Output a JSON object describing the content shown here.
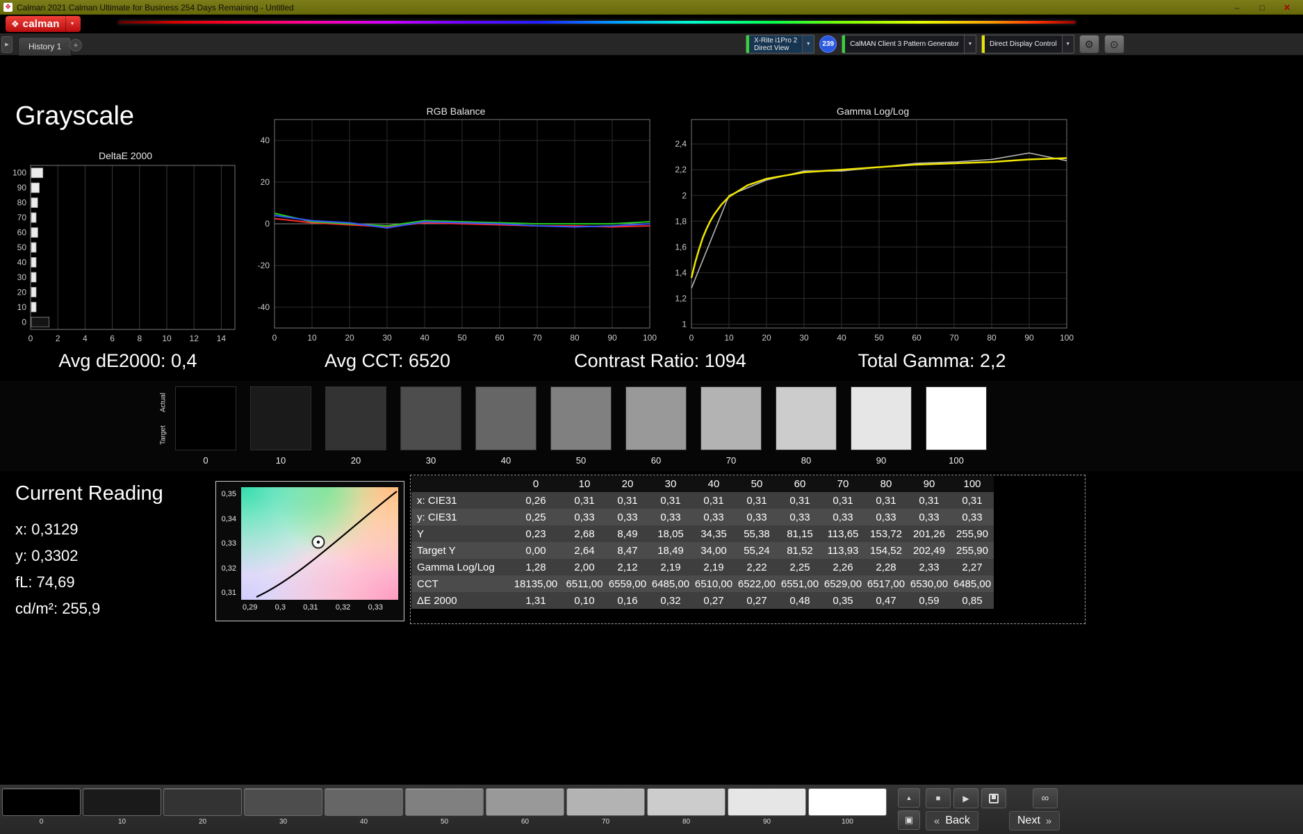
{
  "window": {
    "title": "Calman 2021 Calman Ultimate for Business 254 Days Remaining  - Untitled"
  },
  "icons": {
    "app_diamond": "❖",
    "minimize": "–",
    "maximize": "□",
    "close": "✕",
    "logo_diamond": "❖",
    "dropdown": "▼",
    "collapse": "▶",
    "add_tab": "+",
    "gear": "⚙",
    "power": "⊙",
    "up": "▲",
    "pattern_window": "▣",
    "stop": "■",
    "play": "▶",
    "infinity": "∞",
    "back_chevrons": "«",
    "next_chevrons": "»"
  },
  "brand": {
    "logo": "calman",
    "accent": "#c8102e"
  },
  "tabbar": {
    "history_tab": "History 1"
  },
  "devices": {
    "meter_line1": "X-Rite i1Pro 2",
    "meter_line2": "Direct View",
    "meter_accent": "#35d435",
    "badge": "239",
    "pattern_generator": "CalMAN Client 3 Pattern Generator",
    "pattern_accent": "#35d435",
    "display_control": "Direct Display Control",
    "display_accent": "#e8e400"
  },
  "page": {
    "title": "Grayscale"
  },
  "summary": {
    "avg_de": "Avg dE2000: 0,4",
    "avg_cct": "Avg CCT: 6520",
    "contrast": "Contrast Ratio: 1094",
    "total_gamma": "Total Gamma: 2,2"
  },
  "patches": {
    "row_label_top": "Actual",
    "row_label_bottom": "Target",
    "levels": [
      "0",
      "10",
      "20",
      "30",
      "40",
      "50",
      "60",
      "70",
      "80",
      "90",
      "100"
    ],
    "colors": [
      "#000000",
      "#1a1a1a",
      "#333333",
      "#4d4d4d",
      "#666666",
      "#808080",
      "#999999",
      "#b3b3b3",
      "#cccccc",
      "#e6e6e6",
      "#ffffff"
    ]
  },
  "current_reading": {
    "title": "Current Reading",
    "x": "x: 0,3129",
    "y": "y: 0,3302",
    "fl": "fL: 74,69",
    "cd": "cd/m²: 255,9"
  },
  "cie": {
    "x_ticks": [
      "0,29",
      "0,3",
      "0,31",
      "0,32",
      "0,33"
    ],
    "y_ticks": [
      "0,35",
      "0,34",
      "0,33",
      "0,32",
      "0,31"
    ]
  },
  "table": {
    "columns": [
      "",
      "0",
      "10",
      "20",
      "30",
      "40",
      "50",
      "60",
      "70",
      "80",
      "90",
      "100"
    ],
    "rows": [
      {
        "label": "x: CIE31",
        "values": [
          "0,26",
          "0,31",
          "0,31",
          "0,31",
          "0,31",
          "0,31",
          "0,31",
          "0,31",
          "0,31",
          "0,31",
          "0,31"
        ]
      },
      {
        "label": "y: CIE31",
        "values": [
          "0,25",
          "0,33",
          "0,33",
          "0,33",
          "0,33",
          "0,33",
          "0,33",
          "0,33",
          "0,33",
          "0,33",
          "0,33"
        ]
      },
      {
        "label": "Y",
        "values": [
          "0,23",
          "2,68",
          "8,49",
          "18,05",
          "34,35",
          "55,38",
          "81,15",
          "113,65",
          "153,72",
          "201,26",
          "255,90"
        ]
      },
      {
        "label": "Target Y",
        "values": [
          "0,00",
          "2,64",
          "8,47",
          "18,49",
          "34,00",
          "55,24",
          "81,52",
          "113,93",
          "154,52",
          "202,49",
          "255,90"
        ]
      },
      {
        "label": "Gamma Log/Log",
        "values": [
          "1,28",
          "2,00",
          "2,12",
          "2,19",
          "2,19",
          "2,22",
          "2,25",
          "2,26",
          "2,28",
          "2,33",
          "2,27"
        ]
      },
      {
        "label": "CCT",
        "values": [
          "18135,00",
          "6511,00",
          "6559,00",
          "6485,00",
          "6510,00",
          "6522,00",
          "6551,00",
          "6529,00",
          "6517,00",
          "6530,00",
          "6485,00"
        ]
      },
      {
        "label": "ΔE 2000",
        "values": [
          "1,31",
          "0,10",
          "0,16",
          "0,32",
          "0,27",
          "0,27",
          "0,48",
          "0,35",
          "0,47",
          "0,59",
          "0,85"
        ]
      }
    ]
  },
  "bottom": {
    "patch_labels": [
      "0",
      "10",
      "20",
      "30",
      "40",
      "50",
      "60",
      "70",
      "80",
      "90",
      "100"
    ],
    "back": "Back",
    "next": "Next"
  },
  "chart_data": [
    {
      "type": "bar",
      "orientation": "horizontal",
      "title": "DeltaE 2000",
      "categories": [
        "100",
        "90",
        "80",
        "70",
        "60",
        "50",
        "40",
        "30",
        "20",
        "10",
        "0"
      ],
      "values": [
        0.85,
        0.59,
        0.47,
        0.35,
        0.48,
        0.27,
        0.27,
        0.32,
        0.16,
        0.1,
        1.31
      ],
      "x_ticks": [
        0,
        2,
        4,
        6,
        8,
        10,
        12,
        14
      ],
      "xlim": [
        0,
        15
      ],
      "grid": true,
      "bar_color": "#ececec",
      "zero_bar_color": "#141414"
    },
    {
      "type": "line",
      "title": "RGB Balance",
      "x": [
        0,
        10,
        20,
        30,
        40,
        50,
        60,
        70,
        80,
        90,
        100
      ],
      "x_ticks": [
        0,
        10,
        20,
        30,
        40,
        50,
        60,
        70,
        80,
        90,
        100
      ],
      "y_tick_vals": [
        40,
        20,
        0,
        -20,
        -40
      ],
      "y_tick_labels": [
        "40",
        "20",
        "0",
        "-20",
        "-40"
      ],
      "ylim": [
        -50,
        50
      ],
      "grid": true,
      "series": [
        {
          "name": "Red",
          "color": "#ff2a2a",
          "width": 2,
          "values": [
            2.5,
            0.5,
            -0.5,
            -1.5,
            0.5,
            0,
            -0.5,
            -1,
            -1,
            -1.5,
            -1
          ]
        },
        {
          "name": "Green",
          "color": "#22cc22",
          "width": 2,
          "values": [
            5,
            1,
            0,
            -1,
            1.5,
            1,
            0.5,
            0,
            0,
            0,
            1
          ]
        },
        {
          "name": "Blue",
          "color": "#3355ff",
          "width": 2,
          "values": [
            4,
            1.5,
            0.5,
            -2,
            1,
            0.5,
            0,
            -1,
            -1.5,
            -1,
            0
          ]
        }
      ]
    },
    {
      "type": "line",
      "title": "Gamma Log/Log",
      "x_ticks": [
        0,
        10,
        20,
        30,
        40,
        50,
        60,
        70,
        80,
        90,
        100
      ],
      "y_tick_vals": [
        1,
        1.2,
        1.4,
        1.6,
        1.8,
        2,
        2.2,
        2.4
      ],
      "y_tick_labels": [
        "1",
        "1,2",
        "1,4",
        "1,6",
        "1,8",
        "2",
        "2,2",
        "2,4"
      ],
      "ylim": [
        0.97,
        2.59
      ],
      "grid": true,
      "series": [
        {
          "name": "Measured Gamma",
          "color": "#b8b8b8",
          "width": 1.6,
          "x": [
            0,
            10,
            20,
            30,
            40,
            50,
            60,
            70,
            80,
            90,
            100
          ],
          "values": [
            1.28,
            2.0,
            2.12,
            2.19,
            2.19,
            2.22,
            2.25,
            2.26,
            2.28,
            2.33,
            2.27
          ]
        },
        {
          "name": "Target Gamma 2,2",
          "color": "#f0e600",
          "width": 2.5,
          "x": [
            0,
            1,
            2,
            3,
            4,
            5,
            6,
            8,
            10,
            15,
            20,
            30,
            40,
            50,
            60,
            70,
            80,
            90,
            100
          ],
          "values": [
            1.36,
            1.48,
            1.58,
            1.67,
            1.74,
            1.8,
            1.85,
            1.93,
            1.99,
            2.08,
            2.13,
            2.18,
            2.2,
            2.22,
            2.24,
            2.25,
            2.26,
            2.28,
            2.29
          ]
        }
      ]
    }
  ]
}
